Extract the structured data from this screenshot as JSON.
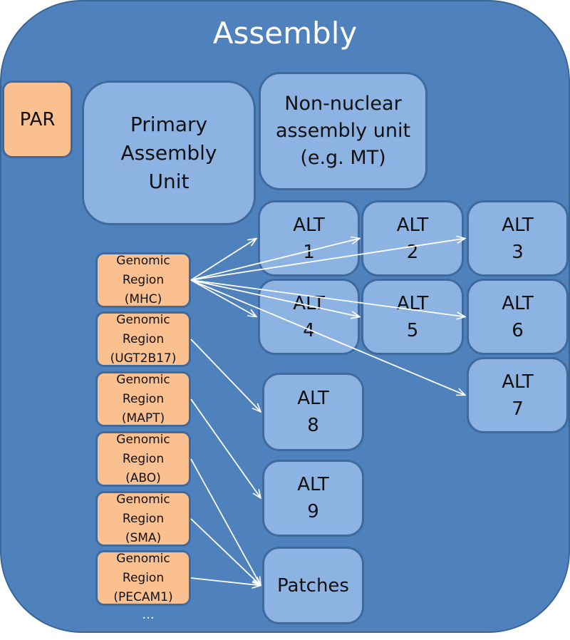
{
  "title": "Assembly",
  "colors": {
    "outer_fill": "#4f81bd",
    "unit_fill": "#8db3e2",
    "region_fill": "#fac090",
    "arrow": "#ffffff"
  },
  "par": {
    "label": "PAR"
  },
  "primary_unit": {
    "label": "Primary\nAssembly\nUnit"
  },
  "non_nuclear_unit": {
    "label": "Non-nuclear\nassembly unit\n(e.g. MT)"
  },
  "alts": [
    {
      "id": "alt1",
      "label": "ALT\n1"
    },
    {
      "id": "alt2",
      "label": "ALT\n2"
    },
    {
      "id": "alt3",
      "label": "ALT\n3"
    },
    {
      "id": "alt4",
      "label": "ALT\n4"
    },
    {
      "id": "alt5",
      "label": "ALT\n5"
    },
    {
      "id": "alt6",
      "label": "ALT\n6"
    },
    {
      "id": "alt7",
      "label": "ALT\n7"
    },
    {
      "id": "alt8",
      "label": "ALT\n8"
    },
    {
      "id": "alt9",
      "label": "ALT\n9"
    }
  ],
  "patches": {
    "id": "patches",
    "label": "Patches"
  },
  "regions": [
    {
      "id": "mhc",
      "label": "Genomic\nRegion\n(MHC)"
    },
    {
      "id": "ugt2b17",
      "label": "Genomic\nRegion\n(UGT2B17)"
    },
    {
      "id": "mapt",
      "label": "Genomic\nRegion\n(MAPT)"
    },
    {
      "id": "abo",
      "label": "Genomic\nRegion\n(ABO)"
    },
    {
      "id": "sma",
      "label": "Genomic\nRegion\n(SMA)"
    },
    {
      "id": "pecam1",
      "label": "Genomic\nRegion\n(PECAM1)"
    }
  ],
  "more_regions": "...",
  "edges": [
    {
      "from": "mhc",
      "to": "alt1"
    },
    {
      "from": "mhc",
      "to": "alt2"
    },
    {
      "from": "mhc",
      "to": "alt3"
    },
    {
      "from": "mhc",
      "to": "alt4"
    },
    {
      "from": "mhc",
      "to": "alt5"
    },
    {
      "from": "mhc",
      "to": "alt6"
    },
    {
      "from": "mhc",
      "to": "alt7"
    },
    {
      "from": "ugt2b17",
      "to": "alt8"
    },
    {
      "from": "mapt",
      "to": "alt9"
    },
    {
      "from": "abo",
      "to": "patches"
    },
    {
      "from": "sma",
      "to": "patches"
    },
    {
      "from": "pecam1",
      "to": "patches"
    }
  ]
}
